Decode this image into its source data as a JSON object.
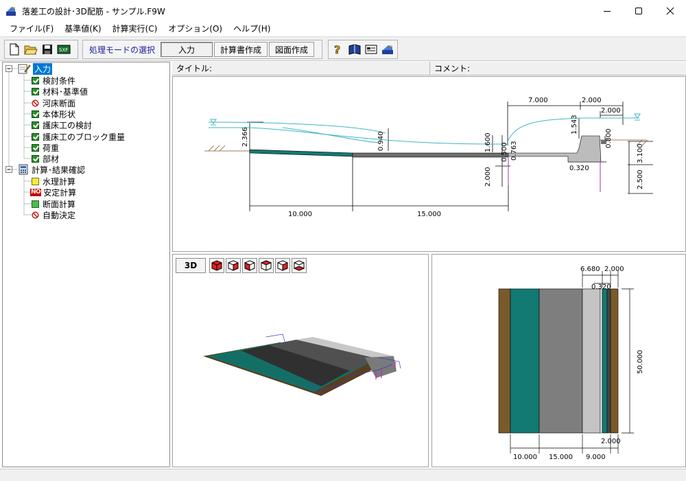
{
  "window": {
    "title": "落差工の設計･3D配筋 - サンプル.F9W",
    "controls": {
      "minimize": "minimize-icon",
      "maximize": "maximize-icon",
      "close": "close-icon"
    }
  },
  "menu": [
    {
      "label": "ファイル(F)"
    },
    {
      "label": "基準値(K)"
    },
    {
      "label": "計算実行(C)"
    },
    {
      "label": "オプション(O)"
    },
    {
      "label": "ヘルプ(H)"
    }
  ],
  "toolbar": {
    "file_buttons": [
      "new-file-icon",
      "open-folder-icon",
      "save-disk-icon",
      "export-icon"
    ],
    "mode_label": "処理モードの選択",
    "mode_value": "入力",
    "report_button": "計算書作成",
    "drawing_button": "図面作成",
    "help_buttons": [
      "help-icon",
      "manual-icon",
      "about-icon",
      "web-icon"
    ]
  },
  "tree": {
    "root1": {
      "label": "入力"
    },
    "input_items": [
      {
        "label": "検討条件",
        "status": "check"
      },
      {
        "label": "材料･基準値",
        "status": "check"
      },
      {
        "label": "河床断面",
        "status": "prohibited"
      },
      {
        "label": "本体形状",
        "status": "check"
      },
      {
        "label": "護床工の検討",
        "status": "check"
      },
      {
        "label": "護床工のブロック重量",
        "status": "check"
      },
      {
        "label": "荷重",
        "status": "check"
      },
      {
        "label": "部材",
        "status": "check"
      }
    ],
    "root2": {
      "label": "計算･結果確認"
    },
    "calc_items": [
      {
        "label": "水理計算",
        "status": "yellow"
      },
      {
        "label": "安定計算",
        "status": "no",
        "badge": "NO"
      },
      {
        "label": "断面計算",
        "status": "green"
      },
      {
        "label": "自動決定",
        "status": "prohibited"
      }
    ]
  },
  "info": {
    "title_label": "タイトル:",
    "comment_label": "コメント:"
  },
  "section_view": {
    "dims": {
      "d7000": "7.000",
      "d2000a": "2.000",
      "d2000b": "2.000",
      "d2366": "2.366",
      "d1543": "1.543",
      "d0800": "0.800",
      "d0940": "0.940",
      "d1600": "1.600",
      "d0763": "0.763",
      "d0500": "0.500",
      "d3100": "3.100",
      "d0320": "0.320",
      "d2000c": "2.000",
      "d2500": "2.500",
      "d10000": "10.000",
      "d15000": "15.000"
    }
  },
  "view3d": {
    "mode_button": "3D",
    "view_buttons": [
      "cube-view-1-icon",
      "cube-view-2-icon",
      "cube-view-3-icon",
      "cube-view-4-icon",
      "cube-view-5-icon",
      "cube-view-6-icon"
    ]
  },
  "plan_view": {
    "dims": {
      "d6680": "6.680",
      "d2000top": "2.000",
      "d0320": "0.320",
      "d50000": "50.000",
      "d2000bottom": "2.000",
      "d10000": "10.000",
      "d15000": "15.000",
      "d9000": "9.000"
    }
  }
}
